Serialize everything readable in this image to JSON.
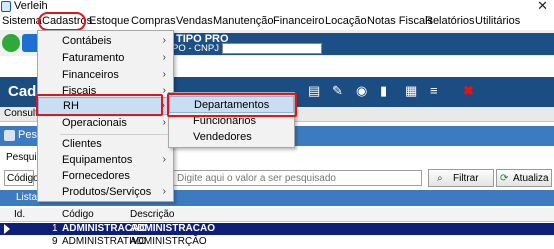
{
  "window": {
    "title": "Verleih",
    "close_glyph": "✕"
  },
  "menubar": {
    "items": [
      "Sistema",
      "Cadastros",
      "Estoque",
      "Compras",
      "Vendas",
      "Manutenção",
      "Financeiro",
      "Locação",
      "Notas Fiscais",
      "Relatórios",
      "Utilitários"
    ]
  },
  "company": {
    "name": "TIPO PRO",
    "cnpj_label": "PO - CNPJ :"
  },
  "window_behind": {
    "title": "Cada",
    "tab": "Consulta",
    "pesquisa_header": "Pesq",
    "pesquisa_label": "Pesquisa",
    "search_field_select": "Código",
    "search_placeholder": "Digite aqui o valor a ser pesquisado",
    "filter_button": "Filtrar",
    "refresh_button": "Atualiza",
    "list_header": "Lista",
    "grid": {
      "columns": [
        "Id.",
        "Código",
        "Descrição"
      ],
      "rows": [
        {
          "id": "1",
          "codigo": "ADMINISTRACAO",
          "descricao": "ADMINISTRACAO",
          "selected": true
        },
        {
          "id": "9",
          "codigo": "ADMINISTRATIVO",
          "descricao": "ADMINISTRÇÃO",
          "selected": false
        }
      ]
    }
  },
  "dropdown": {
    "items": [
      {
        "label": "Contábeis",
        "submenu": true
      },
      {
        "label": "Faturamento",
        "submenu": true
      },
      {
        "label": "Financeiros",
        "submenu": true
      },
      {
        "label": "Fiscais",
        "submenu": true
      },
      {
        "label": "RH",
        "submenu": true,
        "active": true
      },
      {
        "label": "Operacionais",
        "submenu": true
      },
      {
        "label": "Clientes",
        "submenu": false
      },
      {
        "label": "Equipamentos",
        "submenu": true
      },
      {
        "label": "Fornecedores",
        "submenu": false
      },
      {
        "label": "Produtos/Serviços",
        "submenu": true
      }
    ]
  },
  "submenu": {
    "items": [
      {
        "label": "Departamentos",
        "active": true
      },
      {
        "label": "Funcionários",
        "active": false
      },
      {
        "label": "Vendedores",
        "active": false
      }
    ]
  },
  "colors": {
    "highlight_red": "#e0161b",
    "accent_blue": "#1c4f86",
    "selection": "#c9def3"
  },
  "icons": [
    "app-icon",
    "whatsapp-icon",
    "teamviewer-icon",
    "submenu-arrow-icon",
    "filter-icon",
    "refresh-icon"
  ]
}
